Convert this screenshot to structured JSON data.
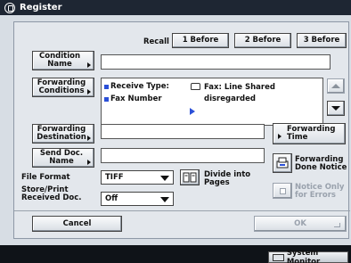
{
  "window": {
    "title": "Register"
  },
  "recall": {
    "label": "Recall",
    "buttons": [
      "1 Before",
      "2 Before",
      "3 Before"
    ]
  },
  "condition_name": {
    "label": "Condition Name",
    "value": ""
  },
  "forwarding_conditions": {
    "label": "Forwarding Conditions",
    "rows": [
      {
        "key": "Receive Type:",
        "value": "Fax: Line Shared"
      },
      {
        "key": "Fax Number",
        "value": "disregarded"
      }
    ]
  },
  "forwarding_destination": {
    "label": "Forwarding Destination",
    "value": ""
  },
  "send_doc_name": {
    "label": "Send Doc. Name",
    "value": ""
  },
  "forwarding_time": {
    "label": "Forwarding Time"
  },
  "file_format": {
    "label": "File Format",
    "selected": "TIFF"
  },
  "divide_into_pages": {
    "label": "Divide into Pages"
  },
  "store_print": {
    "label": "Store/Print Received Doc.",
    "selected": "Off"
  },
  "forwarding_done_notice": {
    "label": "Forwarding Done Notice"
  },
  "notice_only_errors": {
    "label": "Notice Only for Errors"
  },
  "footer": {
    "cancel_label": "Cancel",
    "ok_label": "OK"
  },
  "system_monitor": {
    "label": "System Monitor"
  },
  "icons": {
    "title": "register-icon",
    "fax": "fax-icon",
    "scroll_up": "triangle-up-icon",
    "scroll_down": "triangle-down-icon",
    "divide": "divide-pages-icon",
    "done_notice": "notice-printer-icon",
    "monitor": "monitor-icon"
  },
  "colors": {
    "titlebar": "#1e2633",
    "bullet": "#2b50d8",
    "panel": "#e3e7ec"
  }
}
